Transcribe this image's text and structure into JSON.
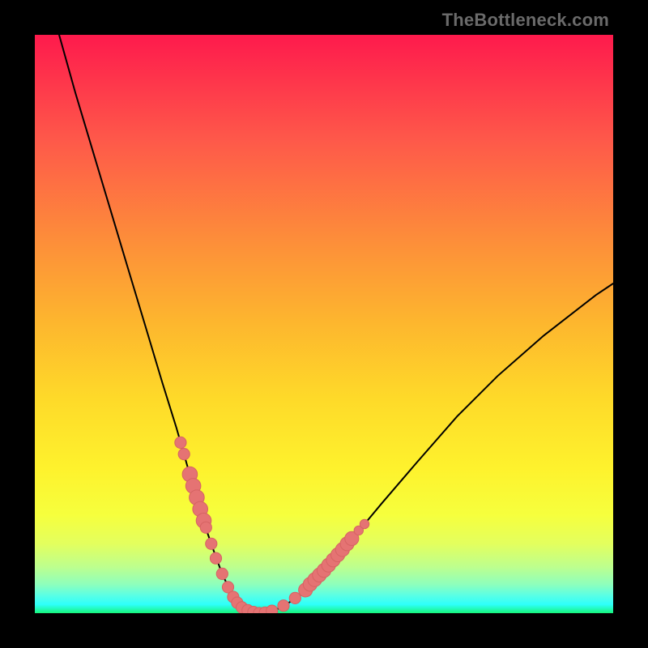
{
  "watermark": "TheBottleneck.com",
  "colors": {
    "frame": "#000000",
    "curve": "#000000",
    "marker_fill": "#e57373",
    "marker_stroke": "#d66363"
  },
  "chart_data": {
    "type": "line",
    "title": "",
    "xlabel": "",
    "ylabel": "",
    "xlim": [
      0,
      100
    ],
    "ylim": [
      0,
      100
    ],
    "gradient_stops": [
      {
        "pos": 0.0,
        "color": "#fe1a4c"
      },
      {
        "pos": 0.18,
        "color": "#fe584a"
      },
      {
        "pos": 0.35,
        "color": "#fd8c3a"
      },
      {
        "pos": 0.5,
        "color": "#fdb72e"
      },
      {
        "pos": 0.63,
        "color": "#feda29"
      },
      {
        "pos": 0.75,
        "color": "#fef22d"
      },
      {
        "pos": 0.83,
        "color": "#f6ff3d"
      },
      {
        "pos": 0.88,
        "color": "#e3ff5e"
      },
      {
        "pos": 0.92,
        "color": "#bdff8e"
      },
      {
        "pos": 0.95,
        "color": "#8effbc"
      },
      {
        "pos": 0.97,
        "color": "#58ffe6"
      },
      {
        "pos": 0.985,
        "color": "#2efffa"
      },
      {
        "pos": 1.0,
        "color": "#17f57a"
      }
    ],
    "series": [
      {
        "name": "bottleneck-curve",
        "x": [
          4.2,
          7.0,
          10.0,
          13.0,
          16.0,
          19.0,
          22.0,
          24.5,
          26.5,
          28.2,
          29.8,
          31.2,
          32.5,
          34.0,
          35.5,
          37.2,
          39.0,
          41.0,
          43.0,
          46.0,
          50.0,
          55.0,
          60.0,
          66.0,
          73.0,
          80.0,
          88.0,
          97.0,
          100.0
        ],
        "y": [
          100.0,
          90.0,
          80.0,
          70.0,
          60.0,
          50.0,
          40.0,
          32.0,
          25.0,
          19.0,
          14.0,
          10.0,
          6.5,
          3.5,
          1.5,
          0.4,
          0.0,
          0.3,
          1.2,
          3.2,
          7.0,
          13.0,
          19.0,
          26.0,
          34.0,
          41.0,
          48.0,
          55.0,
          57.0
        ]
      }
    ],
    "markers": [
      {
        "x": 25.2,
        "y": 29.5,
        "r": 1.0
      },
      {
        "x": 25.8,
        "y": 27.5,
        "r": 1.0
      },
      {
        "x": 26.8,
        "y": 24.0,
        "r": 1.3
      },
      {
        "x": 27.4,
        "y": 22.0,
        "r": 1.3
      },
      {
        "x": 28.0,
        "y": 20.0,
        "r": 1.3
      },
      {
        "x": 28.6,
        "y": 18.0,
        "r": 1.3
      },
      {
        "x": 29.2,
        "y": 16.0,
        "r": 1.3
      },
      {
        "x": 29.6,
        "y": 14.8,
        "r": 1.0
      },
      {
        "x": 30.5,
        "y": 12.0,
        "r": 1.0
      },
      {
        "x": 31.3,
        "y": 9.5,
        "r": 1.0
      },
      {
        "x": 32.4,
        "y": 6.8,
        "r": 1.0
      },
      {
        "x": 33.4,
        "y": 4.5,
        "r": 1.0
      },
      {
        "x": 34.3,
        "y": 2.8,
        "r": 1.0
      },
      {
        "x": 35.0,
        "y": 1.8,
        "r": 1.0
      },
      {
        "x": 35.8,
        "y": 1.0,
        "r": 1.0
      },
      {
        "x": 36.8,
        "y": 0.5,
        "r": 1.0
      },
      {
        "x": 37.8,
        "y": 0.2,
        "r": 1.0
      },
      {
        "x": 38.8,
        "y": 0.0,
        "r": 1.0
      },
      {
        "x": 39.8,
        "y": 0.1,
        "r": 1.0
      },
      {
        "x": 41.0,
        "y": 0.4,
        "r": 1.0
      },
      {
        "x": 43.0,
        "y": 1.3,
        "r": 1.0
      },
      {
        "x": 45.0,
        "y": 2.6,
        "r": 1.0
      },
      {
        "x": 46.8,
        "y": 4.0,
        "r": 1.2
      },
      {
        "x": 47.6,
        "y": 5.0,
        "r": 1.2
      },
      {
        "x": 48.4,
        "y": 5.8,
        "r": 1.2
      },
      {
        "x": 49.2,
        "y": 6.6,
        "r": 1.2
      },
      {
        "x": 50.0,
        "y": 7.4,
        "r": 1.2
      },
      {
        "x": 50.8,
        "y": 8.3,
        "r": 1.2
      },
      {
        "x": 51.6,
        "y": 9.2,
        "r": 1.2
      },
      {
        "x": 52.4,
        "y": 10.1,
        "r": 1.2
      },
      {
        "x": 53.2,
        "y": 11.0,
        "r": 1.2
      },
      {
        "x": 54.0,
        "y": 12.0,
        "r": 1.2
      },
      {
        "x": 54.8,
        "y": 12.9,
        "r": 1.2
      },
      {
        "x": 56.0,
        "y": 14.3,
        "r": 0.8
      },
      {
        "x": 57.0,
        "y": 15.4,
        "r": 0.8
      }
    ]
  }
}
